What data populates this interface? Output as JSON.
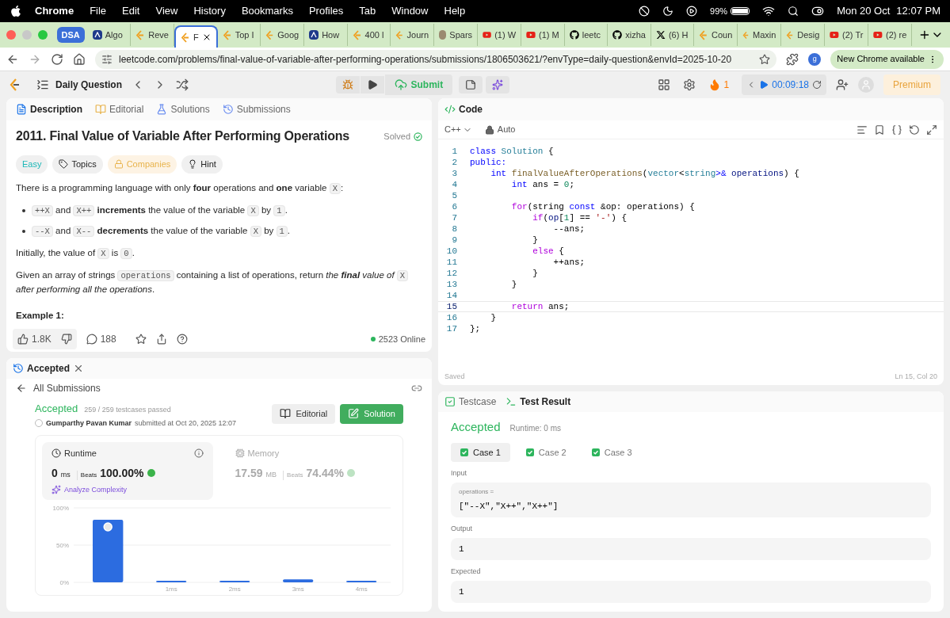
{
  "menubar": {
    "app": "Chrome",
    "menus": [
      "File",
      "Edit",
      "View",
      "History",
      "Bookmarks",
      "Profiles",
      "Tab",
      "Window",
      "Help"
    ],
    "battery": "99%",
    "date": "Mon 20 Oct",
    "time": "12:07 PM"
  },
  "browser": {
    "group": "DSA",
    "tabs": [
      {
        "title": "Algo",
        "kind": "algo",
        "selected": false
      },
      {
        "title": "Reve",
        "kind": "lc",
        "selected": false
      },
      {
        "title": "F",
        "kind": "lc",
        "selected": true
      },
      {
        "title": "Top I",
        "kind": "lc",
        "selected": false
      },
      {
        "title": "Goog",
        "kind": "lc",
        "selected": false
      },
      {
        "title": "How",
        "kind": "algo",
        "selected": false
      },
      {
        "title": "400 l",
        "kind": "lc",
        "selected": false
      },
      {
        "title": "Journ",
        "kind": "lc",
        "selected": false
      },
      {
        "title": "Spars",
        "kind": "other",
        "selected": false
      },
      {
        "title": "(1) W",
        "kind": "yt",
        "selected": false
      },
      {
        "title": "(1) M",
        "kind": "yt",
        "selected": false
      },
      {
        "title": "leetc",
        "kind": "gh",
        "selected": false
      },
      {
        "title": "xizha",
        "kind": "gh",
        "selected": false
      },
      {
        "title": "(6) H",
        "kind": "x",
        "selected": false
      },
      {
        "title": "Coun",
        "kind": "lc",
        "selected": false
      },
      {
        "title": "Maxin",
        "kind": "lc",
        "selected": false
      },
      {
        "title": "Desig",
        "kind": "lc",
        "selected": false
      },
      {
        "title": "(2) Tr",
        "kind": "yt",
        "selected": false
      },
      {
        "title": "(2) re",
        "kind": "yt",
        "selected": false
      }
    ],
    "url": "leetcode.com/problems/final-value-of-variable-after-performing-operations/submissions/1806503621/?envType=daily-question&envId=2025-10-20",
    "profile": "g",
    "update": "New Chrome available"
  },
  "header": {
    "title": "Daily Question",
    "submit": "Submit",
    "streak": "1",
    "timer": "00:09:18",
    "premium": "Premium"
  },
  "description": {
    "tabs": [
      {
        "label": "Description",
        "selected": true
      },
      {
        "label": "Editorial",
        "selected": false
      },
      {
        "label": "Solutions",
        "selected": false
      },
      {
        "label": "Submissions",
        "selected": false
      }
    ],
    "title": "2011. Final Value of Variable After Performing Operations",
    "status": "Solved",
    "tags": [
      {
        "label": "Easy",
        "kind": "difficulty"
      },
      {
        "label": "Topics",
        "kind": "topics"
      },
      {
        "label": "Companies",
        "kind": "companies"
      },
      {
        "label": "Hint",
        "kind": "hint"
      }
    ],
    "paragraphs": [
      {
        "kind": "text",
        "segs": [
          {
            "t": "There is a programming language with only **four** operations and **one** variable "
          },
          {
            "c": "X"
          },
          {
            "t": ":"
          }
        ]
      },
      {
        "kind": "bullet",
        "segs": [
          {
            "c": "++X"
          },
          {
            "t": " and "
          },
          {
            "c": "X++"
          },
          {
            "t": " **increments** the value of the variable "
          },
          {
            "c": "X"
          },
          {
            "t": " by "
          },
          {
            "c": "1"
          },
          {
            "t": "."
          }
        ]
      },
      {
        "kind": "bullet",
        "segs": [
          {
            "c": "--X"
          },
          {
            "t": " and "
          },
          {
            "c": "X--"
          },
          {
            "t": " **decrements** the value of the variable "
          },
          {
            "c": "X"
          },
          {
            "t": " by "
          },
          {
            "c": "1"
          },
          {
            "t": "."
          }
        ]
      },
      {
        "kind": "text",
        "segs": [
          {
            "t": "Initially, the value of "
          },
          {
            "c": "X"
          },
          {
            "t": " is "
          },
          {
            "c": "0"
          },
          {
            "t": "."
          }
        ]
      },
      {
        "kind": "text",
        "segs": [
          {
            "t": "Given an array of strings "
          },
          {
            "c": "operations"
          },
          {
            "t": " containing a list of operations, return "
          },
          {
            "t": "the **final** value of ",
            "italic": true
          },
          {
            "c": "X"
          },
          {
            "t": " after performing all the operations",
            "italic": true
          },
          {
            "t": "."
          }
        ]
      },
      {
        "kind": "heading",
        "segs": [
          {
            "t": "Example 1:"
          }
        ]
      }
    ],
    "likes": "1.8K",
    "comments": "188",
    "online": "2523 Online"
  },
  "submission": {
    "tab": "Accepted",
    "back": "All Submissions",
    "status": "Accepted",
    "passed": "259 / 259 testcases passed",
    "user": "Gumparthy Pavan Kumar",
    "submitted": "submitted at Oct 20, 2025 12:07",
    "buttons": [
      {
        "label": "Editorial",
        "kind": "editorial"
      },
      {
        "label": "Solution",
        "kind": "solution"
      }
    ],
    "stats": [
      {
        "title": "Runtime",
        "value": "0",
        "unit": "ms",
        "beats_label": "Beats",
        "beats": "100.00%",
        "selected": true,
        "action": "Analyze Complexity"
      },
      {
        "title": "Memory",
        "value": "17.59",
        "unit": "MB",
        "beats_label": "Beats",
        "beats": "74.44%",
        "selected": false
      }
    ],
    "chart_data": {
      "type": "bar",
      "categories": [
        null,
        "1ms",
        "2ms",
        "3ms",
        "4ms"
      ],
      "values": [
        84,
        2,
        2,
        4,
        2
      ],
      "ylim": [
        0,
        100
      ],
      "yticks": [
        {
          "value": 0,
          "label": "0%"
        },
        {
          "value": 50,
          "label": "50%"
        },
        {
          "value": 100,
          "label": "100%"
        }
      ]
    }
  },
  "code": {
    "title": "Code",
    "language": "C++",
    "mode": "Auto",
    "saved": "Saved",
    "position": "Ln 15, Col 20",
    "lines": [
      {
        "n": "1",
        "current": false,
        "segs": [
          {
            "kind": "kw",
            "t": "class "
          },
          {
            "kind": "type",
            "t": "Solution"
          },
          {
            "kind": "p",
            "t": " {"
          }
        ]
      },
      {
        "n": "2",
        "current": false,
        "segs": [
          {
            "kind": "kw",
            "t": "public:"
          }
        ]
      },
      {
        "n": "3",
        "current": false,
        "segs": [
          {
            "kind": "kw",
            "t": "    int "
          },
          {
            "kind": "fn",
            "t": "finalValueAfterOperations"
          },
          {
            "kind": "p",
            "t": "("
          },
          {
            "kind": "type",
            "t": "vector"
          },
          {
            "kind": "p",
            "t": "<"
          },
          {
            "kind": "type",
            "t": "string"
          },
          {
            "kind": "kw",
            "t": ">& "
          },
          {
            "kind": "var",
            "t": "operations"
          },
          {
            "kind": "p",
            "t": ") {"
          }
        ]
      },
      {
        "n": "4",
        "current": false,
        "segs": [
          {
            "kind": "kw",
            "t": "        int "
          },
          {
            "kind": "p",
            "t": "ans = "
          },
          {
            "kind": "num",
            "t": "0"
          },
          {
            "kind": "p",
            "t": ";"
          }
        ]
      },
      {
        "n": "5",
        "current": false
      },
      {
        "n": "6",
        "current": false,
        "segs": [
          {
            "kind": "ctrl",
            "t": "        for"
          },
          {
            "kind": "p",
            "t": "(string "
          },
          {
            "kind": "kw",
            "t": "const "
          },
          {
            "kind": "p",
            "t": "&op: operations) {"
          }
        ]
      },
      {
        "n": "7",
        "current": false,
        "segs": [
          {
            "kind": "ctrl",
            "t": "            if"
          },
          {
            "kind": "p",
            "t": "("
          },
          {
            "kind": "var",
            "t": "op"
          },
          {
            "kind": "p",
            "t": "["
          },
          {
            "kind": "num",
            "t": "1"
          },
          {
            "kind": "p",
            "t": "] == "
          },
          {
            "kind": "str",
            "t": "'-'"
          },
          {
            "kind": "p",
            "t": ") {"
          }
        ]
      },
      {
        "n": "8",
        "current": false,
        "segs": [
          {
            "kind": "p",
            "t": "                --ans;"
          }
        ]
      },
      {
        "n": "9",
        "current": false,
        "segs": [
          {
            "kind": "p",
            "t": "            }"
          }
        ]
      },
      {
        "n": "10",
        "current": false,
        "segs": [
          {
            "kind": "ctrl",
            "t": "            else"
          },
          {
            "kind": "p",
            "t": " {"
          }
        ]
      },
      {
        "n": "11",
        "current": false,
        "segs": [
          {
            "kind": "p",
            "t": "                ++ans;"
          }
        ]
      },
      {
        "n": "12",
        "current": false,
        "segs": [
          {
            "kind": "p",
            "t": "            }"
          }
        ]
      },
      {
        "n": "13",
        "current": false,
        "segs": [
          {
            "kind": "p",
            "t": "        }"
          }
        ]
      },
      {
        "n": "14",
        "current": false
      },
      {
        "n": "15",
        "current": true,
        "segs": [
          {
            "kind": "ctrl",
            "t": "        return"
          },
          {
            "kind": "p",
            "t": " ans;"
          }
        ]
      },
      {
        "n": "16",
        "current": false,
        "segs": [
          {
            "kind": "p",
            "t": "    }"
          }
        ]
      },
      {
        "n": "17",
        "current": false,
        "segs": [
          {
            "kind": "p",
            "t": "};"
          }
        ]
      }
    ]
  },
  "result": {
    "tabs": [
      {
        "label": "Testcase",
        "kind": "testcase",
        "selected": false
      },
      {
        "label": "Test Result",
        "kind": "result",
        "selected": true
      }
    ],
    "status": "Accepted",
    "runtime": "Runtime: 0 ms",
    "cases": [
      {
        "label": "Case 1",
        "selected": true
      },
      {
        "label": "Case 2",
        "selected": false
      },
      {
        "label": "Case 3",
        "selected": false
      }
    ],
    "input_label": "Input",
    "param": "operations =",
    "input": "[\"--X\",\"X++\",\"X++\"]",
    "output_label": "Output",
    "output": "1",
    "expected_label": "Expected",
    "expected": "1"
  }
}
